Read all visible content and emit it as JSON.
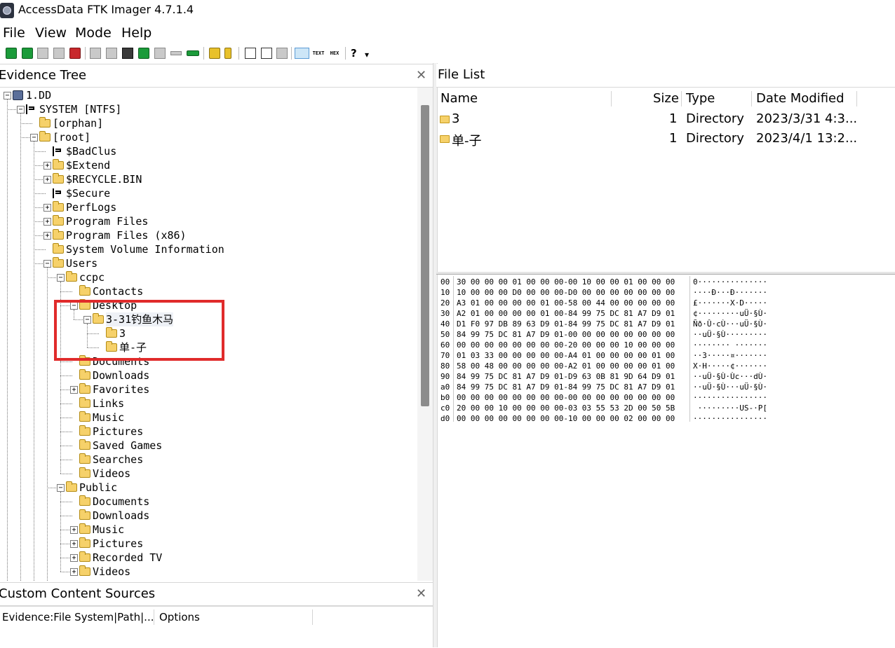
{
  "title": "AccessData FTK Imager 4.7.1.4",
  "menu": [
    "File",
    "View",
    "Mode",
    "Help"
  ],
  "toolbar": {
    "text_btn": "TEXT",
    "hex_btn": "HEX",
    "help_glyph": "?",
    "more_glyph": "▾"
  },
  "evidence_tree": {
    "title": "Evidence Tree",
    "nodes": [
      {
        "label": "1.DD",
        "depth": 0,
        "icon": "disk-icon",
        "expander": "minus"
      },
      {
        "label": "SYSTEM [NTFS]",
        "depth": 1,
        "icon": "filesystem-icon",
        "expander": "minus"
      },
      {
        "label": "[orphan]",
        "depth": 2,
        "icon": "folder-icon",
        "expander": "none"
      },
      {
        "label": "[root]",
        "depth": 2,
        "icon": "folder-icon",
        "expander": "minus"
      },
      {
        "label": "$BadClus",
        "depth": 3,
        "icon": "filesystem-icon",
        "expander": "none"
      },
      {
        "label": "$Extend",
        "depth": 3,
        "icon": "folder-icon",
        "expander": "plus"
      },
      {
        "label": "$RECYCLE.BIN",
        "depth": 3,
        "icon": "folder-icon",
        "expander": "plus"
      },
      {
        "label": "$Secure",
        "depth": 3,
        "icon": "filesystem-icon",
        "expander": "none"
      },
      {
        "label": "PerfLogs",
        "depth": 3,
        "icon": "folder-icon",
        "expander": "plus"
      },
      {
        "label": "Program Files",
        "depth": 3,
        "icon": "folder-icon",
        "expander": "plus"
      },
      {
        "label": "Program Files (x86)",
        "depth": 3,
        "icon": "folder-icon",
        "expander": "plus"
      },
      {
        "label": "System Volume Information",
        "depth": 3,
        "icon": "folder-icon",
        "expander": "none"
      },
      {
        "label": "Users",
        "depth": 3,
        "icon": "folder-icon",
        "expander": "minus"
      },
      {
        "label": "ccpc",
        "depth": 4,
        "icon": "folder-icon",
        "expander": "minus"
      },
      {
        "label": "Contacts",
        "depth": 5,
        "icon": "folder-icon",
        "expander": "none"
      },
      {
        "label": "Desktop",
        "depth": 5,
        "icon": "folder-icon",
        "expander": "minus"
      },
      {
        "label": "3-31钓鱼木马",
        "depth": 6,
        "icon": "folder-icon",
        "expander": "minus",
        "selected": true
      },
      {
        "label": "3",
        "depth": 7,
        "icon": "folder-icon",
        "expander": "none"
      },
      {
        "label": "单-子",
        "depth": 7,
        "icon": "folder-icon",
        "expander": "none"
      },
      {
        "label": "Documents",
        "depth": 5,
        "icon": "folder-icon",
        "expander": "none"
      },
      {
        "label": "Downloads",
        "depth": 5,
        "icon": "folder-icon",
        "expander": "none"
      },
      {
        "label": "Favorites",
        "depth": 5,
        "icon": "folder-icon",
        "expander": "plus"
      },
      {
        "label": "Links",
        "depth": 5,
        "icon": "folder-icon",
        "expander": "none"
      },
      {
        "label": "Music",
        "depth": 5,
        "icon": "folder-icon",
        "expander": "none"
      },
      {
        "label": "Pictures",
        "depth": 5,
        "icon": "folder-icon",
        "expander": "none"
      },
      {
        "label": "Saved Games",
        "depth": 5,
        "icon": "folder-icon",
        "expander": "none"
      },
      {
        "label": "Searches",
        "depth": 5,
        "icon": "folder-icon",
        "expander": "none"
      },
      {
        "label": "Videos",
        "depth": 5,
        "icon": "folder-icon",
        "expander": "none"
      },
      {
        "label": "Public",
        "depth": 4,
        "icon": "folder-icon",
        "expander": "minus"
      },
      {
        "label": "Documents",
        "depth": 5,
        "icon": "folder-icon",
        "expander": "none"
      },
      {
        "label": "Downloads",
        "depth": 5,
        "icon": "folder-icon",
        "expander": "none"
      },
      {
        "label": "Music",
        "depth": 5,
        "icon": "folder-icon",
        "expander": "plus"
      },
      {
        "label": "Pictures",
        "depth": 5,
        "icon": "folder-icon",
        "expander": "plus"
      },
      {
        "label": "Recorded TV",
        "depth": 5,
        "icon": "folder-icon",
        "expander": "plus"
      },
      {
        "label": "Videos",
        "depth": 5,
        "icon": "folder-icon",
        "expander": "plus"
      }
    ]
  },
  "custom_content": {
    "title": "Custom Content Sources",
    "columns": [
      "Evidence:File System|Path|...",
      "Options"
    ]
  },
  "file_list": {
    "title": "File List",
    "columns": [
      "Name",
      "Size",
      "Type",
      "Date Modified"
    ],
    "rows": [
      {
        "name": "3",
        "size": "1",
        "type": "Directory",
        "date": "2023/3/31 4:3..."
      },
      {
        "name": "单-子",
        "size": "1",
        "type": "Directory",
        "date": "2023/4/1 13:2..."
      }
    ]
  },
  "hex": {
    "rows": [
      {
        "off": "00",
        "bytes": "30 00 00 00 01 00 00 00-00 10 00 00 01 00 00 00",
        "ascii": "0···············"
      },
      {
        "off": "10",
        "bytes": "10 00 00 00 D0 00 00 00-D0 00 00 00 00 00 00 00",
        "ascii": "····Ð···Ð·······"
      },
      {
        "off": "20",
        "bytes": "A3 01 00 00 00 00 01 00-58 00 44 00 00 00 00 00",
        "ascii": "£·······X·D·····"
      },
      {
        "off": "30",
        "bytes": "A2 01 00 00 00 00 01 00-84 99 75 DC 81 A7 D9 01",
        "ascii": "¢·········uÜ·§Ù·"
      },
      {
        "off": "40",
        "bytes": "D1 F0 97 DB 89 63 D9 01-84 99 75 DC 81 A7 D9 01",
        "ascii": "Ñð·Û·cÙ···uÜ·§Ù·"
      },
      {
        "off": "50",
        "bytes": "84 99 75 DC 81 A7 D9 01-00 00 00 00 00 00 00 00",
        "ascii": "··uÜ·§Ù·········"
      },
      {
        "off": "60",
        "bytes": "00 00 00 00 00 00 00 00-20 00 00 00 10 00 00 00",
        "ascii": "········ ·······"
      },
      {
        "off": "70",
        "bytes": "01 03 33 00 00 00 00 00-A4 01 00 00 00 00 01 00",
        "ascii": "··3·····¤·······"
      },
      {
        "off": "80",
        "bytes": "58 00 48 00 00 00 00 00-A2 01 00 00 00 00 01 00",
        "ascii": "X·H·····¢·······"
      },
      {
        "off": "90",
        "bytes": "84 99 75 DC 81 A7 D9 01-D9 63 0B 81 9D 64 D9 01",
        "ascii": "··uÜ·§Ù·Ùc···dÙ·"
      },
      {
        "off": "a0",
        "bytes": "84 99 75 DC 81 A7 D9 01-84 99 75 DC 81 A7 D9 01",
        "ascii": "··uÜ·§Ù···uÜ·§Ù·"
      },
      {
        "off": "b0",
        "bytes": "00 00 00 00 00 00 00 00-00 00 00 00 00 00 00 00",
        "ascii": "················"
      },
      {
        "off": "c0",
        "bytes": "20 00 00 10 00 00 00 00-03 03 55 53 2D 00 50 5B",
        "ascii": " ·········US-·P["
      },
      {
        "off": "d0",
        "bytes": "00 00 00 00 00 00 00 00-10 00 00 00 02 00 00 00",
        "ascii": "················"
      }
    ]
  }
}
